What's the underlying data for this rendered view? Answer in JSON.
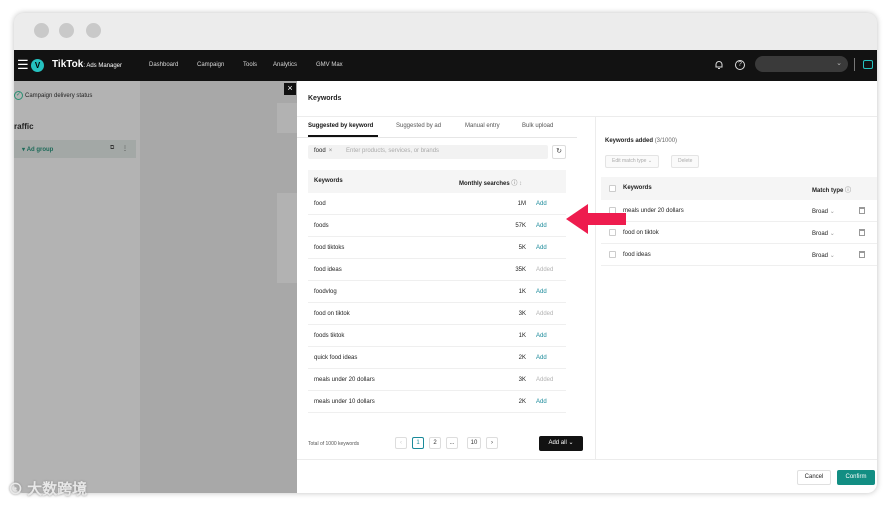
{
  "colors": {
    "accent": "#128e83",
    "link": "#1a8a9a",
    "arrow": "#ee1c4e",
    "nav_bg": "#121212"
  },
  "topnav": {
    "menu_icon": "hamburger-icon",
    "avatar_letter": "V",
    "brand": "TikTok",
    "brand_sub": ": Ads Manager",
    "items": [
      "Dashboard",
      "Campaign",
      "Tools",
      "Analytics",
      "GMV Max"
    ]
  },
  "background": {
    "status": "Campaign delivery status",
    "traffic": "raffic",
    "adgroup": "Ad group"
  },
  "drawer": {
    "title": "Keywords",
    "tabs": [
      "Suggested by keyword",
      "Suggested by ad",
      "Manual entry",
      "Bulk upload"
    ],
    "search": {
      "chip": "food",
      "placeholder": "Enter products, services, or brands"
    },
    "table": {
      "headers": [
        "Keywords",
        "Monthly searches"
      ],
      "rows": [
        {
          "keyword": "food",
          "searches": "1M",
          "action": "Add"
        },
        {
          "keyword": "foods",
          "searches": "57K",
          "action": "Add"
        },
        {
          "keyword": "food tiktoks",
          "searches": "5K",
          "action": "Add"
        },
        {
          "keyword": "food ideas",
          "searches": "35K",
          "action": "Added"
        },
        {
          "keyword": "foodvlog",
          "searches": "1K",
          "action": "Add"
        },
        {
          "keyword": "food on tiktok",
          "searches": "3K",
          "action": "Added"
        },
        {
          "keyword": "foods tiktok",
          "searches": "1K",
          "action": "Add"
        },
        {
          "keyword": "quick food ideas",
          "searches": "2K",
          "action": "Add"
        },
        {
          "keyword": "meals under 20 dollars",
          "searches": "3K",
          "action": "Added"
        },
        {
          "keyword": "meals under 10 dollars",
          "searches": "2K",
          "action": "Add"
        }
      ]
    },
    "total": "Total of 1000 keywords",
    "pages": [
      "1",
      "2",
      "...",
      "10"
    ],
    "add_all": "Add all",
    "added": {
      "title": "Keywords added",
      "count": "(3/1000)",
      "edit_match": "Edit match type",
      "delete": "Delete",
      "headers": [
        "Keywords",
        "Match type"
      ],
      "rows": [
        {
          "keyword": "meals under 20 dollars",
          "match": "Broad"
        },
        {
          "keyword": "food on tiktok",
          "match": "Broad"
        },
        {
          "keyword": "food ideas",
          "match": "Broad"
        }
      ]
    },
    "cancel": "Cancel",
    "confirm": "Confirm"
  },
  "watermark": "大数跨境"
}
